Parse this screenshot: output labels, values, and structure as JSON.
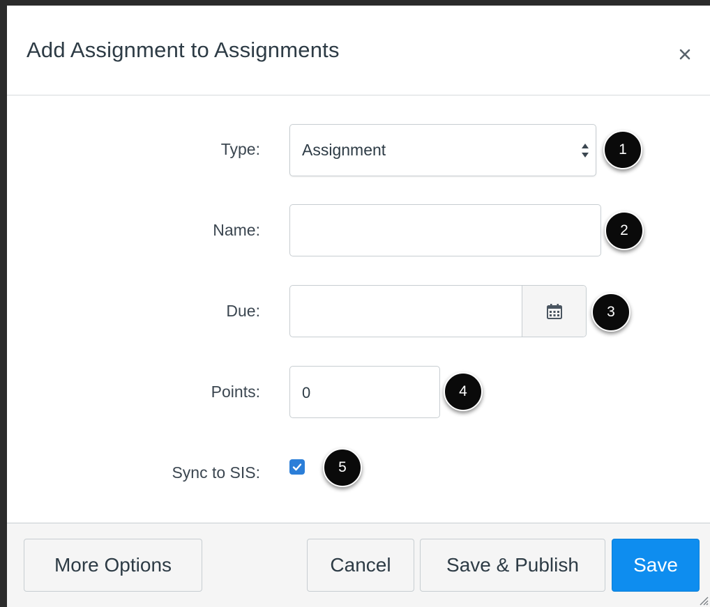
{
  "dialog": {
    "title": "Add Assignment to Assignments",
    "close_icon": "close-icon"
  },
  "form": {
    "type": {
      "label": "Type:",
      "selected": "Assignment",
      "icon": "sort-arrows-icon"
    },
    "name": {
      "label": "Name:",
      "value": ""
    },
    "due": {
      "label": "Due:",
      "value": "",
      "icon": "calendar-icon"
    },
    "points": {
      "label": "Points:",
      "value": "0"
    },
    "sync": {
      "label": "Sync to SIS:",
      "checked": true,
      "icon": "checkmark-icon"
    }
  },
  "callouts": [
    "1",
    "2",
    "3",
    "4",
    "5"
  ],
  "footer": {
    "more_options": "More Options",
    "cancel": "Cancel",
    "save_publish": "Save & Publish",
    "save": "Save"
  },
  "colors": {
    "primary": "#0e8def",
    "checkbox": "#2b7ed8",
    "callout": "#0a0a0a",
    "text": "#2d3b45"
  }
}
